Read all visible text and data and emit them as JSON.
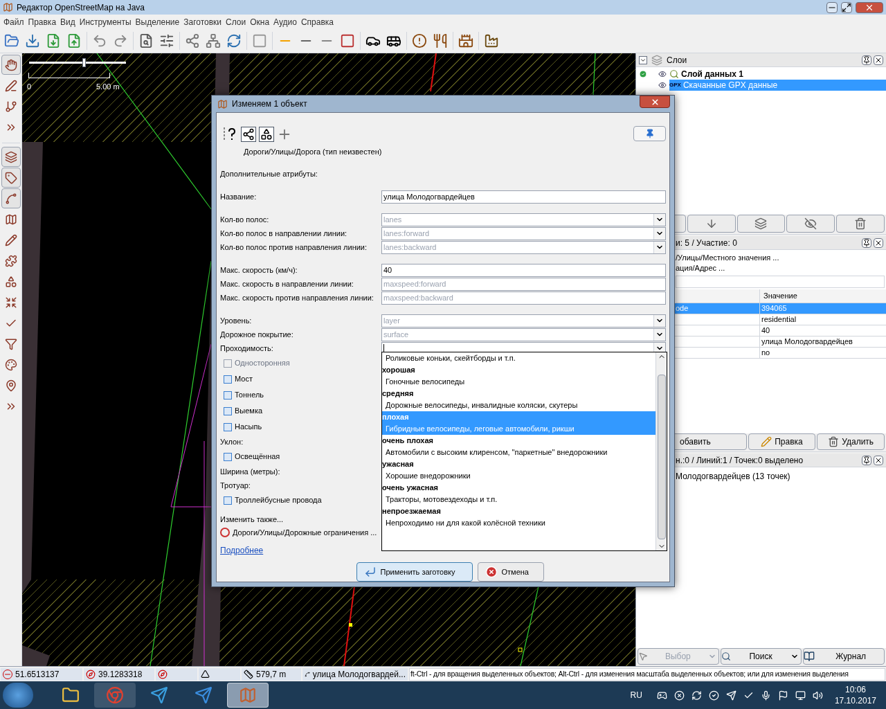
{
  "window": {
    "title": "Редактор OpenStreetMap на Java"
  },
  "menu": [
    "Файл",
    "Правка",
    "Вид",
    "Инструменты",
    "Выделение",
    "Заготовки",
    "Слои",
    "Окна",
    "Аудио",
    "Справка"
  ],
  "map": {
    "scale_start": "0",
    "scale_label": "5.00 m",
    "zoom": {
      "level": 0.57
    }
  },
  "layers_panel": {
    "title": "Слои",
    "layers": [
      {
        "name": "Слой данных 1",
        "active": true,
        "selected": false
      },
      {
        "name": "Скачанные GPX данные",
        "badge": "GPX",
        "active": false,
        "selected": true
      }
    ]
  },
  "properties_panel": {
    "title": "и: 5 / Участие: 0",
    "presets": [
      "/Улицы/Местного значения ...",
      "ация/Адрес ..."
    ],
    "columns": [
      "Значение"
    ],
    "rows": [
      {
        "key": "ode",
        "value": "394065",
        "selected": true
      },
      {
        "value": "residential",
        "selected": false
      },
      {
        "value": "40",
        "selected": false
      },
      {
        "value": "улица Молодогвардейцев",
        "selected": false
      },
      {
        "value": "no",
        "selected": false
      }
    ],
    "buttons": [
      "обавить",
      "Правка",
      "Удалить"
    ]
  },
  "selection_panel": {
    "title": "н.:0 / Линий:1 / Точек:0 выделено",
    "items": [
      "Молодогвардейцев (13 точек)"
    ],
    "buttons": [
      {
        "label": "Выбор",
        "disabled": true,
        "has_menu": true
      },
      {
        "label": "Поиск",
        "disabled": false,
        "has_menu": true
      },
      {
        "label": "Журнал",
        "disabled": false,
        "has_menu": false
      }
    ]
  },
  "dialog": {
    "title": "Изменяем 1 объект",
    "preset_path": "Дороги/Улицы/Дорога (тип неизвестен)",
    "section": "Дополнительные атрибуты:",
    "groups": [
      [
        {
          "kind": "text",
          "label": "Название:",
          "value": "улица Молодогвардейцев"
        }
      ],
      [
        {
          "kind": "combo",
          "label": "Кол-во полос:",
          "placeholder": "lanes"
        },
        {
          "kind": "combo",
          "label": "Кол-во полос в направлении линии:",
          "placeholder": "lanes:forward"
        },
        {
          "kind": "combo",
          "label": "Кол-во полос против направления линии:",
          "placeholder": "lanes:backward"
        }
      ],
      [
        {
          "kind": "text",
          "label": "Макс. скорость (км/ч):",
          "value": "40"
        },
        {
          "kind": "text",
          "label": "Макс. скорость в направлении линии:",
          "placeholder": "maxspeed:forward"
        },
        {
          "kind": "text",
          "label": "Макс. скорость против направления линии:",
          "placeholder": "maxspeed:backward"
        }
      ],
      [
        {
          "kind": "combo",
          "label": "Уровень:",
          "placeholder": "layer"
        },
        {
          "kind": "combo",
          "label": "Дорожное покрытие:",
          "placeholder": "surface"
        },
        {
          "kind": "combo",
          "label": "Проходимость:",
          "focused": true
        },
        {
          "kind": "check",
          "label": "Односторонняя",
          "checked": false,
          "disabled": true
        },
        {
          "kind": "check",
          "label": "Мост",
          "checked": false,
          "disabled": false
        },
        {
          "kind": "check",
          "label": "Тоннель",
          "checked": false,
          "disabled": false
        },
        {
          "kind": "check",
          "label": "Выемка",
          "checked": false,
          "disabled": false
        },
        {
          "kind": "check",
          "label": "Насыпь",
          "checked": false,
          "disabled": false
        },
        {
          "kind": "label",
          "label": "Уклон:"
        },
        {
          "kind": "check",
          "label": "Освещённая",
          "checked": false,
          "disabled": false
        },
        {
          "kind": "label",
          "label": "Ширина (метры):"
        },
        {
          "kind": "label",
          "label": "Тротуар:"
        },
        {
          "kind": "check",
          "label": "Троллейбусные провода",
          "checked": false,
          "disabled": false
        }
      ]
    ],
    "also_label": "Изменить также...",
    "also_preset": "Дороги/Улицы/Дорожные ограничения ...",
    "more_link": "Подробнее",
    "buttons": [
      "Применить заготовку",
      "Отмена"
    ],
    "dropdown": {
      "items": [
        {
          "description": "Роликовые коньки, скейтборды и т.п.",
          "selected": false
        },
        {
          "title": "хорошая",
          "description": "Гоночные велосипеды",
          "selected": false
        },
        {
          "title": "средняя",
          "description": "Дорожные велосипеды, инвалидные коляски, скутеры",
          "selected": false
        },
        {
          "title": "плохая",
          "description": "Гибридные велосипеды, леговые автомобили, рикши",
          "selected": true
        },
        {
          "title": "очень плохая",
          "description": "Автомобили с высоким клиренсом, \"паркетные\" внедорожники",
          "selected": false
        },
        {
          "title": "ужасная",
          "description": "Хорошие внедорожники",
          "selected": false
        },
        {
          "title": "очень ужасная",
          "description": "Тракторы, мотовездеходы и т.п.",
          "selected": false
        },
        {
          "title": "непроезжаемая",
          "description": "Непроходимо ни для какой колёсной техники",
          "selected": false
        }
      ]
    }
  },
  "status_bar": {
    "latitude": "51.6513137",
    "longitude": "39.1283318",
    "distance": "579,7 m",
    "name": "улица Молодогвардей...",
    "help": "ft-Ctrl - для вращения выделенных объектов; Alt-Ctrl - для изменения масштаба выделенных объектов; или для изменения выделения"
  },
  "taskbar": {
    "apps": [
      {
        "selected": false
      },
      {
        "selected": false
      },
      {
        "selected": false
      },
      {
        "selected": false
      },
      {
        "selected": true
      }
    ],
    "language": "RU",
    "time": "10:06",
    "date": "17.10.2017"
  }
}
